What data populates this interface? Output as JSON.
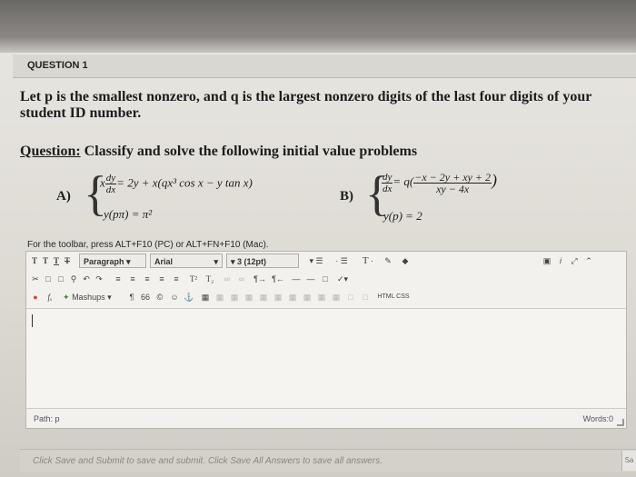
{
  "question": {
    "header": "QUESTION 1",
    "intro_part1": "Let p is the smallest ",
    "intro_bold1": "nonzero",
    "intro_part2": ", and q is the largest ",
    "intro_bold2": "nonzero",
    "intro_part3": " digits of the last four digits of your",
    "intro_line2": "student ID number.",
    "sub_label": "Question:",
    "sub_text": " Classify and solve the following initial value problems",
    "eqA": {
      "label": "A)",
      "line1_prefix": "x",
      "frac_num": "dy",
      "frac_den": "dx",
      "line1_rest": "= 2y + x(qx³ cos x − y tan x)",
      "line2": "y(pπ) = π²"
    },
    "eqB": {
      "label": "B)",
      "frac_num": "dy",
      "frac_den": "dx",
      "mid": "= q(",
      "big_num": "−x − 2y + xy + 2",
      "big_den": "xy − 4x",
      "close": ")",
      "line2": "y(p) = 2"
    }
  },
  "editor": {
    "toolbar_hint": "For the toolbar, press ALT+F10 (PC) or ALT+FN+F10 (Mac).",
    "row1": {
      "t1": "T",
      "t2": "T",
      "t3": "T",
      "t4": "T",
      "paragraph": "Paragraph",
      "font": "Arial",
      "size": "3 (12pt)",
      "text_color": "T"
    },
    "row2": {
      "cut": "✂",
      "superscript": "T²",
      "subscript": "T₂"
    },
    "row3": {
      "mashups": "Mashups",
      "pilcrow": "¶",
      "quote": "66",
      "html": "HTML",
      "css": "CSS"
    },
    "status_path": "Path: p",
    "words": "Words:0"
  },
  "footer": {
    "text": "Click Save and Submit to save and submit. Click Save All Answers to save all answers."
  },
  "edge_button": "Sa"
}
